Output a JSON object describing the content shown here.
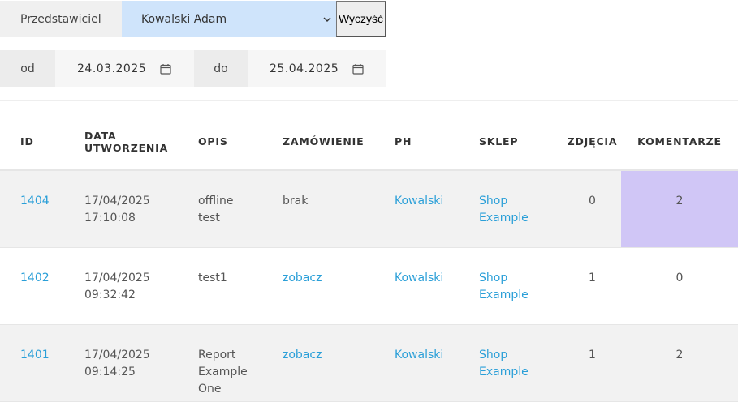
{
  "filters": {
    "rep_label": "Przedstawiciel",
    "rep_selected": "Kowalski Adam",
    "clear_button": "Wyczyść",
    "from_label": "od",
    "from_date": "24.03.2025",
    "to_label": "do",
    "to_date": "25.04.2025"
  },
  "table": {
    "headers": {
      "id": "ID",
      "created_1": "DATA",
      "created_2": "UTWORZENIA",
      "desc": "OPIS",
      "order": "ZAMÓWIENIE",
      "ph": "PH",
      "shop": "SKLEP",
      "photos": "ZDJĘCIA",
      "comments": "KOMENTARZE"
    },
    "rows": [
      {
        "id": "1404",
        "date": "17/04/2025",
        "time": "17:10:08",
        "desc_1": "offline",
        "desc_2": "test",
        "desc_3": "",
        "order": "brak",
        "ph": "Kowalski",
        "shop_1": "Shop",
        "shop_2": "Example",
        "photos": "0",
        "comments": "2"
      },
      {
        "id": "1402",
        "date": "17/04/2025",
        "time": "09:32:42",
        "desc_1": "test1",
        "desc_2": "",
        "desc_3": "",
        "order": "zobacz",
        "ph": "Kowalski",
        "shop_1": "Shop",
        "shop_2": "Example",
        "photos": "1",
        "comments": "0"
      },
      {
        "id": "1401",
        "date": "17/04/2025",
        "time": "09:14:25",
        "desc_1": "Report",
        "desc_2": "Example",
        "desc_3": "One",
        "order": "zobacz",
        "ph": "Kowalski",
        "shop_1": "Shop",
        "shop_2": "Example",
        "photos": "1",
        "comments": "2"
      }
    ]
  },
  "colors": {
    "link": "#2a9fd8",
    "select_bg": "#cfe4fb",
    "highlight_comments": "#d0c6f6",
    "row_alt": "#f2f2f2"
  },
  "icons": {
    "select": "chevron-down-icon",
    "date": "calendar-icon"
  }
}
